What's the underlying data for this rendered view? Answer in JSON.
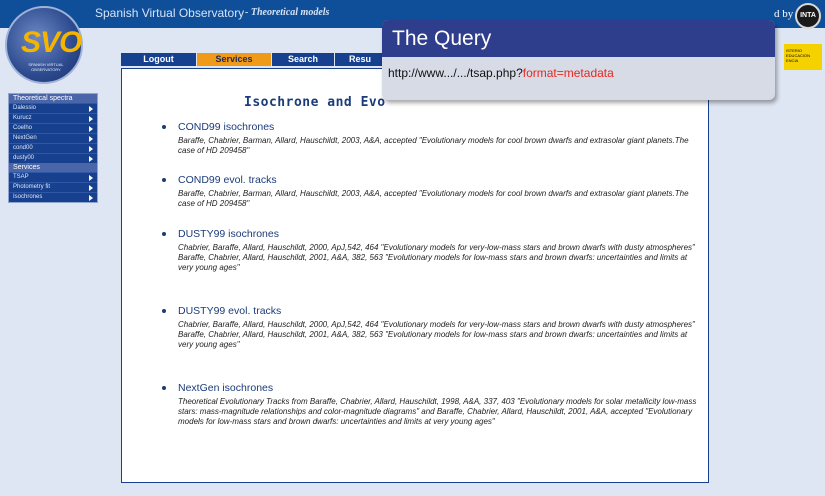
{
  "banner": {
    "title": "Spanish Virtual Observatory",
    "subtitle": "- Theoretical models",
    "right_text": "d by",
    "right_logo_text": "INTA"
  },
  "logo": {
    "main": "SVO",
    "small": "SPANISH VIRTUAL OBSERVATORY"
  },
  "ministry": {
    "text": "ISTERIO EDUCACION ENCIA"
  },
  "nav": {
    "items": [
      {
        "label": "Logout",
        "active": false
      },
      {
        "label": "Services",
        "active": true
      },
      {
        "label": "Search",
        "active": false
      },
      {
        "label": "Resu",
        "active": false
      }
    ]
  },
  "sidebar": {
    "sections": [
      {
        "header": "Theoretical spectra",
        "items": [
          "Dalessio",
          "Kurucz",
          "Coelho",
          "NextGen",
          "cond00",
          "dusty00"
        ]
      },
      {
        "header": "Services",
        "items": [
          "TSAP",
          "Photometry fit",
          "Isochrones"
        ]
      }
    ]
  },
  "main": {
    "title": "Isochrone and Evo",
    "entries": [
      {
        "title": "COND99 isochrones",
        "desc": "Baraffe, Chabrier, Barman, Allard, Hauschildt, 2003, A&A, accepted \"Evolutionary models for cool brown dwarfs and extrasolar giant planets.The case of HD 209458\""
      },
      {
        "title": "COND99 evol. tracks",
        "desc": "Baraffe, Chabrier, Barman, Allard, Hauschildt, 2003, A&A, accepted \"Evolutionary models for cool brown dwarfs and extrasolar giant planets.The case of HD 209458\""
      },
      {
        "title": "DUSTY99 isochrones",
        "desc": "Chabrier, Baraffe, Allard, Hauschildt, 2000, ApJ,542, 464 \"Evolutionary models for very-low-mass stars and brown dwarfs with dusty atmospheres\"\nBaraffe, Chabrier, Allard, Hauschildt, 2001, A&A, 382, 563 \"Evolutionary models for low-mass stars and brown dwarfs: uncertainties and limits at very young ages\""
      },
      {
        "title": "DUSTY99 evol. tracks",
        "desc": "Chabrier, Baraffe, Allard, Hauschildt, 2000, ApJ,542, 464 \"Evolutionary models for very-low-mass stars and brown dwarfs with dusty atmospheres\"\nBaraffe, Chabrier, Allard, Hauschildt, 2001, A&A, 382, 563 \"Evolutionary models for low-mass stars and brown dwarfs: uncertainties and limits at very young ages\""
      },
      {
        "title": "NextGen isochrones",
        "desc": "Theoretical Evolutionary Tracks from Baraffe, Chabrier, Allard, Hauschildt, 1998, A&A, 337, 403 \"Evolutionary models for solar metallicity low-mass stars: mass-magnitude relationships and color-magnitude diagrams\" and Baraffe, Chabrier, Allard, Hauschildt, 2001, A&A, accepted \"Evolutionary models for low-mass stars and brown dwarfs: uncertainties and limits at very young ages\""
      }
    ]
  },
  "overlay": {
    "title": "The Query",
    "url_prefix": "http://www.../.../tsap.php?",
    "url_param": "format=metadata"
  },
  "colors": {
    "banner": "#0f4f9a",
    "nav": "#17408e",
    "nav_active": "#f09a1a",
    "overlay_head": "#2f3e8c",
    "accent": "#e8281e"
  }
}
